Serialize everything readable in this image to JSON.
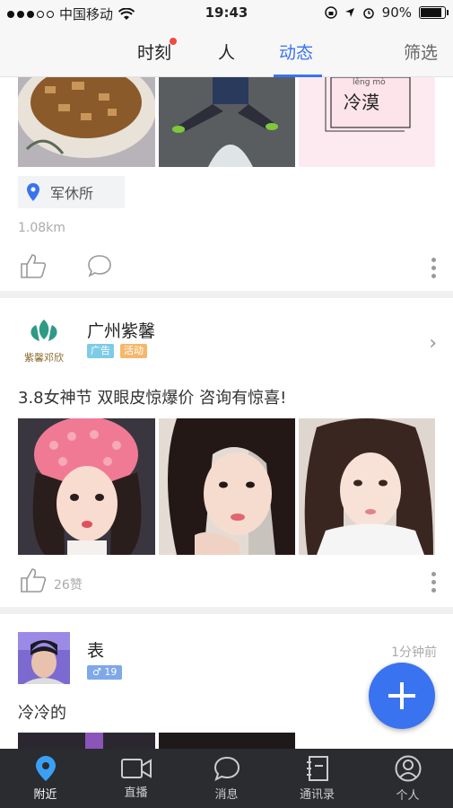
{
  "status_bar": {
    "carrier": "中国移动",
    "time": "19:43",
    "battery": "90%",
    "battery_level": 0.9
  },
  "tabs": [
    {
      "label": "时刻",
      "has_badge": true
    },
    {
      "label": "人"
    },
    {
      "label": "动态",
      "active": true
    },
    {
      "label": "筛选"
    }
  ],
  "post1": {
    "image3_text": "冷漠",
    "image3_pinyin": "lěng mò",
    "location": "军休所",
    "distance": "1.08km"
  },
  "post2": {
    "name": "广州紫馨",
    "logo_text": "紫馨邓欣",
    "tags": [
      {
        "label": "广告",
        "color": "#7ecbe6"
      },
      {
        "label": "活动",
        "color": "#f5b86b"
      }
    ],
    "text": "3.8女神节 双眼皮惊爆价 咨询有惊喜!",
    "likes": "26赞"
  },
  "post3": {
    "name": "表",
    "gender_tag": "♂ 19",
    "time": "1分钟前",
    "text": "冷冷的"
  },
  "bottom_nav": [
    {
      "label": "附近",
      "icon": "location-pin-icon",
      "active": true
    },
    {
      "label": "直播",
      "icon": "video-camera-icon"
    },
    {
      "label": "消息",
      "icon": "chat-bubble-icon"
    },
    {
      "label": "通讯录",
      "icon": "contacts-book-icon"
    },
    {
      "label": "个人",
      "icon": "user-profile-icon"
    }
  ],
  "colors": {
    "accent": "#3a73f0",
    "badge_red": "#f04a3e",
    "bottom_bar": "#2a2c30"
  }
}
